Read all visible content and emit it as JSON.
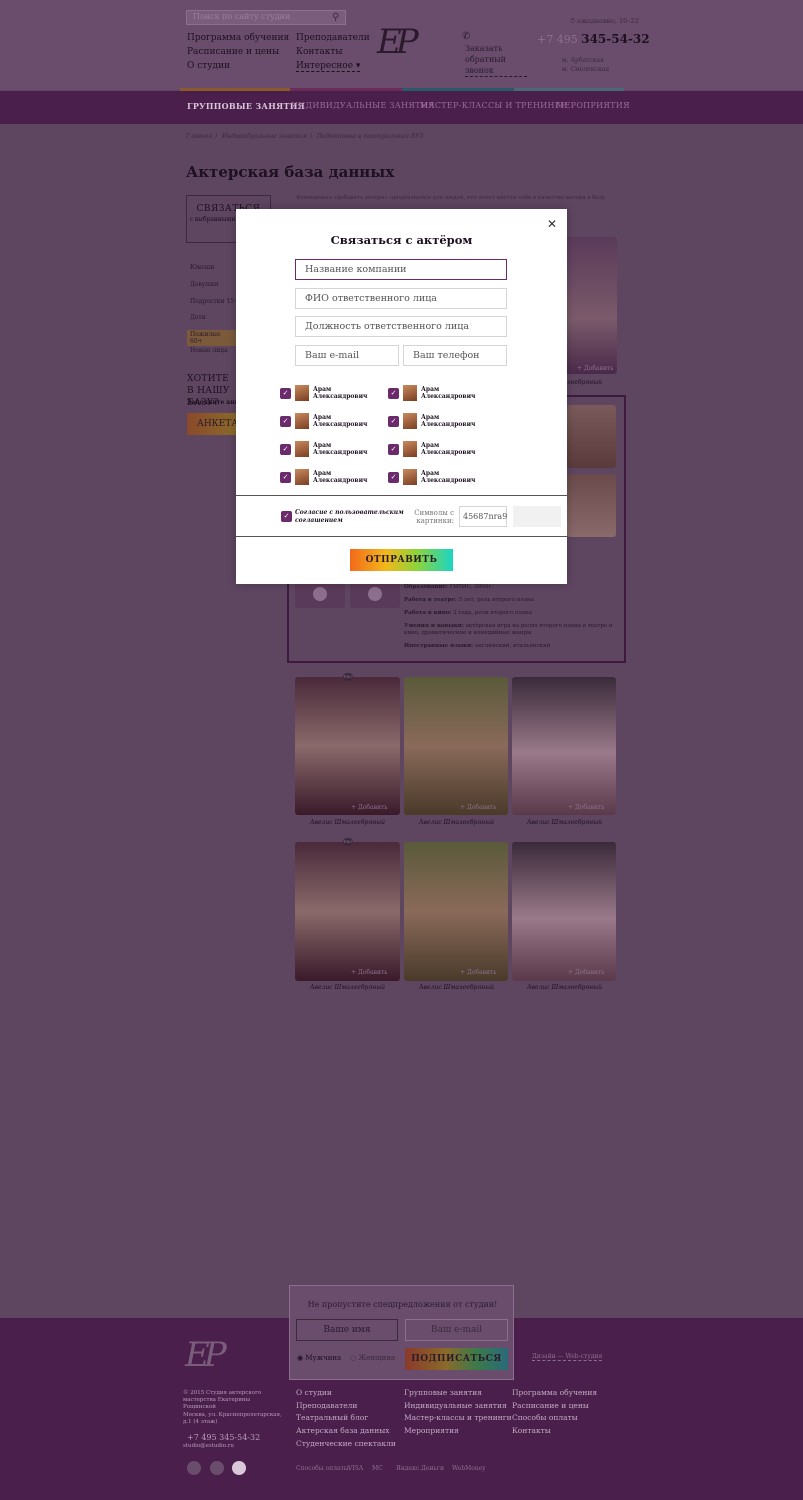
{
  "header": {
    "search_placeholder": "Поиск по сайту студии",
    "links_left": [
      "Программа обучения",
      "Расписание и цены",
      "О студии"
    ],
    "links_mid": [
      "Преподаватели",
      "Контакты",
      "Интересное ▾"
    ],
    "call": "Заказать обратный звонок",
    "hours": "ежедневно, 10–22",
    "phone_code": "+7 495",
    "phone_number": "345-54-32",
    "metro": [
      "м. Арбатская",
      "м. Смоленская"
    ]
  },
  "nav": [
    "ГРУППОВЫЕ ЗАНЯТИЯ",
    "ИНДИВИДУАЛЬНЫЕ ЗАНЯТИЯ",
    "МАСТЕР-КЛАССЫ И ТРЕНИНГИ",
    "МЕРОПРИЯТИЯ"
  ],
  "breadcrumbs": "Главная 〉 Индивидуальные занятия 〉 Подготовка в театральный ВУЗ",
  "page_title": "Актерская база данных",
  "intro": "Функционал «добавить актера» предназначен для людей, кто хочет внести себя в качестве актера в базу",
  "left": {
    "contact_title": "СВЯЗАТЬСЯ",
    "contact_sub": "с выбранными актерами",
    "categories": [
      "Юноши",
      "Девушки",
      "Подростки 15+",
      "Дети",
      "Пожилые 60+",
      "Новые лица"
    ],
    "want_title": "ХОТИТЕ В НАШУ БАЗУ?",
    "want_sub": "Заполните анкету",
    "anketa_btn": "АНКЕТА"
  },
  "cards": {
    "caption": "Авелис Шмалеебряный",
    "add_label": "+ Добавить",
    "badge": "PRO"
  },
  "actor_info": [
    {
      "label": "Образование:",
      "text": "ГИТИС, 2004г."
    },
    {
      "label": "Работа в театре:",
      "text": "5 лет, роль второго плана"
    },
    {
      "label": "Работа в кино:",
      "text": "2 года, роли второго плана"
    },
    {
      "label": "Умения и навыки:",
      "text": "актёрская игра на ролях второго плана в театре и кино, драматические и комедийные жанры"
    },
    {
      "label": "Иностранные языки:",
      "text": "английский, итальянский"
    }
  ],
  "modal": {
    "title": "Связаться с актёром",
    "company_placeholder": "Название компании",
    "fio_placeholder": "ФИО ответственного лица",
    "position_placeholder": "Должность ответственного лица",
    "email_placeholder": "Ваш e-mail",
    "phone_placeholder": "Ваш телефон",
    "actors": [
      {
        "first": "Арам",
        "last": "Александрович"
      },
      {
        "first": "Арам",
        "last": "Александрович"
      },
      {
        "first": "Арам",
        "last": "Александрович"
      },
      {
        "first": "Арам",
        "last": "Александрович"
      },
      {
        "first": "Арам",
        "last": "Александрович"
      },
      {
        "first": "Арам",
        "last": "Александрович"
      },
      {
        "first": "Арам",
        "last": "Александрович"
      },
      {
        "first": "Арам",
        "last": "Александрович"
      }
    ],
    "agree": "Согласие с пользовательским соглашением",
    "symbols_label": "Символы с картинки:",
    "captcha_value": "45687nra9",
    "send": "ОТПРАВИТЬ",
    "accent": "#6b2a6c"
  },
  "subscribe": {
    "title": "Не пропустите спецпредложения от студии!",
    "name_placeholder": "Ваше имя",
    "email_placeholder": "Ваш e-mail",
    "gender_male": "Мужчина",
    "gender_female": "Женщина",
    "button": "ПОДПИСАТЬСЯ"
  },
  "footer": {
    "copyright": "© 2015 Студия актерского мастерства Екатерины Рощинской",
    "address": "Москва, ул. Краснопролетарская, д.1 (4 этаж)",
    "phone": "+7 495 345-54-32",
    "email": "studio@estudio.ru",
    "col1": [
      "О студии",
      "Преподаватели",
      "Театральный блог",
      "Актерская база данных",
      "Студенческие спектакли"
    ],
    "col2": [
      "Групповые занятия",
      "Индивидуальные занятия",
      "Мастер-классы и тренинги",
      "Мероприятия"
    ],
    "col3": [
      "Программа обучения",
      "Расписание и цены",
      "Способы оплаты",
      "Контакты"
    ],
    "pay_label": "Способы оплаты:",
    "pay": [
      "VISA",
      "MC",
      "Яндекс.Деньги",
      "WebMoney"
    ],
    "made_by": "Дизайн — Web-студия"
  }
}
